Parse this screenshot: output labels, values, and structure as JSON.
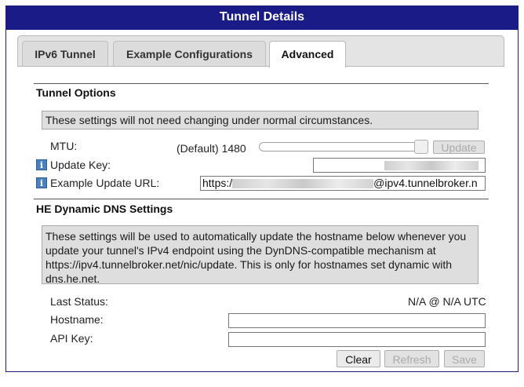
{
  "window": {
    "title": "Tunnel Details"
  },
  "tabs": [
    {
      "label": "IPv6 Tunnel"
    },
    {
      "label": "Example Configurations"
    },
    {
      "label": "Advanced"
    }
  ],
  "tunnel_options": {
    "heading": "Tunnel Options",
    "notice": "These settings will not need changing under normal circumstances.",
    "mtu_label": "MTU:",
    "mtu_value": "(Default) 1480",
    "mtu_slider_fraction": 0.93,
    "update_button": "Update",
    "update_key_label": "Update Key:",
    "update_url_label": "Example Update URL:",
    "update_url_prefix": "https:/",
    "update_url_suffix": "@ipv4.tunnelbroker.n"
  },
  "dns": {
    "heading": "HE Dynamic DNS Settings",
    "notice": "These settings will be used to automatically update the hostname below whenever you update your tunnel's IPv4 endpoint using the DynDNS-compatible mechanism at https://ipv4.tunnelbroker.net/nic/update. This is only for hostnames set dynamic with dns.he.net.",
    "last_status_label": "Last Status:",
    "last_status_value": "N/A @ N/A UTC",
    "hostname_label": "Hostname:",
    "api_key_label": "API Key:",
    "buttons": {
      "clear": "Clear",
      "refresh": "Refresh",
      "save": "Save"
    }
  },
  "icons": {
    "info": "info-icon"
  },
  "colors": {
    "titlebar": "#1b1b88",
    "notice_bg": "#dedede"
  }
}
